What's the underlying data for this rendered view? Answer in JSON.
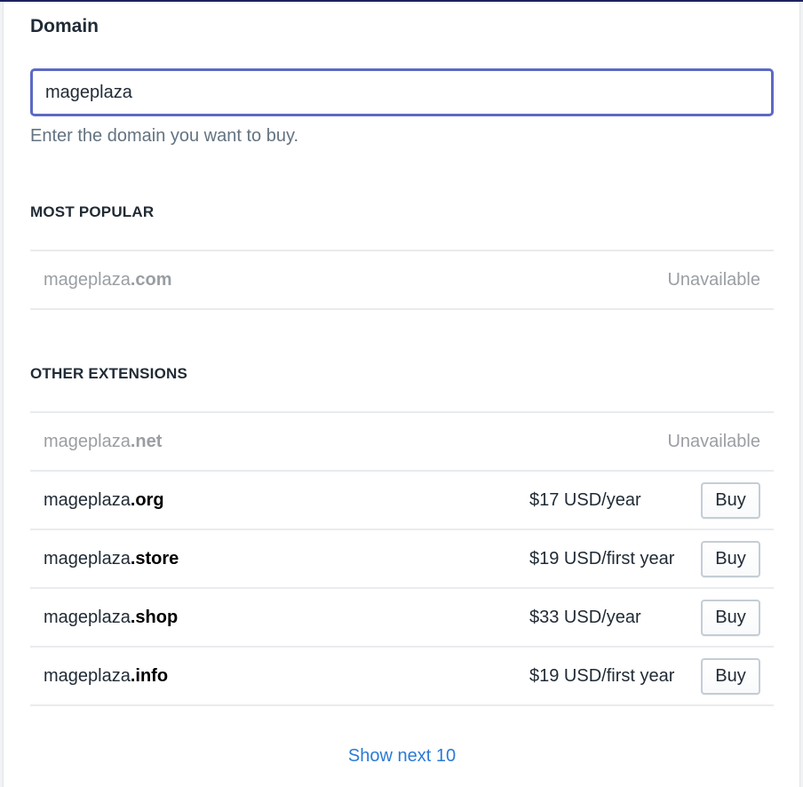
{
  "colors": {
    "accent": "#5c6ac4",
    "link": "#2c7ad6",
    "top_bar": "#1c2260",
    "muted_text": "#9a9ea3"
  },
  "domain_field": {
    "label": "Domain",
    "value": "mageplaza",
    "help_text": "Enter the domain you want to buy."
  },
  "most_popular": {
    "heading": "MOST POPULAR",
    "items": [
      {
        "name": "mageplaza",
        "ext": ".com",
        "available": false,
        "status": "Unavailable"
      }
    ]
  },
  "other_extensions": {
    "heading": "OTHER EXTENSIONS",
    "items": [
      {
        "name": "mageplaza",
        "ext": ".net",
        "available": false,
        "status": "Unavailable"
      },
      {
        "name": "mageplaza",
        "ext": ".org",
        "available": true,
        "price": "$17 USD/year",
        "button": "Buy"
      },
      {
        "name": "mageplaza",
        "ext": ".store",
        "available": true,
        "price": "$19 USD/first year",
        "button": "Buy"
      },
      {
        "name": "mageplaza",
        "ext": ".shop",
        "available": true,
        "price": "$33 USD/year",
        "button": "Buy"
      },
      {
        "name": "mageplaza",
        "ext": ".info",
        "available": true,
        "price": "$19 USD/first year",
        "button": "Buy"
      }
    ]
  },
  "show_next": {
    "label": "Show next 10"
  }
}
